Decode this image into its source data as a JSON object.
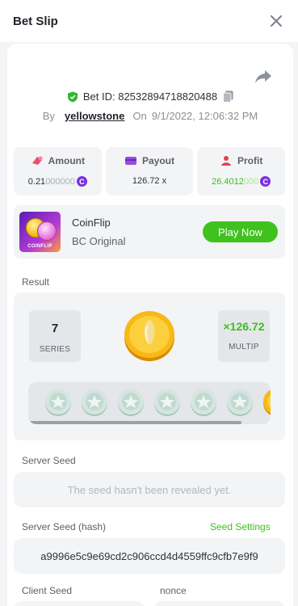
{
  "header": {
    "title": "Bet Slip",
    "close_icon": "close-icon"
  },
  "bet": {
    "id_label": "Bet ID: 82532894718820488",
    "by_label": "By",
    "username": "yellowstone",
    "on_label": "On",
    "datetime": "9/1/2022, 12:06:32 PM"
  },
  "stats": {
    "amount": {
      "label": "Amount",
      "value_main": "0.21",
      "value_dim": "000000",
      "currency_symbol": "C"
    },
    "payout": {
      "label": "Payout",
      "value": "126.72 x"
    },
    "profit": {
      "label": "Profit",
      "value_main": "26.4012",
      "value_dim": "000",
      "currency_symbol": "C"
    }
  },
  "game": {
    "name": "CoinFlip",
    "subtitle": "BC Original",
    "thumb_label": "COINFLIP",
    "play_label": "Play Now"
  },
  "result": {
    "section_label": "Result",
    "series_value": "7",
    "series_caption": "SERIES",
    "multiplier_value": "×126.72",
    "multiplier_caption": "MULTIP"
  },
  "seeds": {
    "server_seed_label": "Server Seed",
    "server_seed_placeholder": "The seed hasn't been revealed yet.",
    "server_seed_hash_label": "Server Seed (hash)",
    "seed_settings_link": "Seed Settings",
    "server_seed_hash": "a9996e5c9e69cd2c906ccd4d4559ffc9cfb7e9f9",
    "client_seed_label": "Client Seed",
    "nonce_label": "nonce"
  },
  "colors": {
    "accent_green": "#3fc21e",
    "currency_purple": "#7b2fe0",
    "coin_gold": "#f4b400"
  }
}
